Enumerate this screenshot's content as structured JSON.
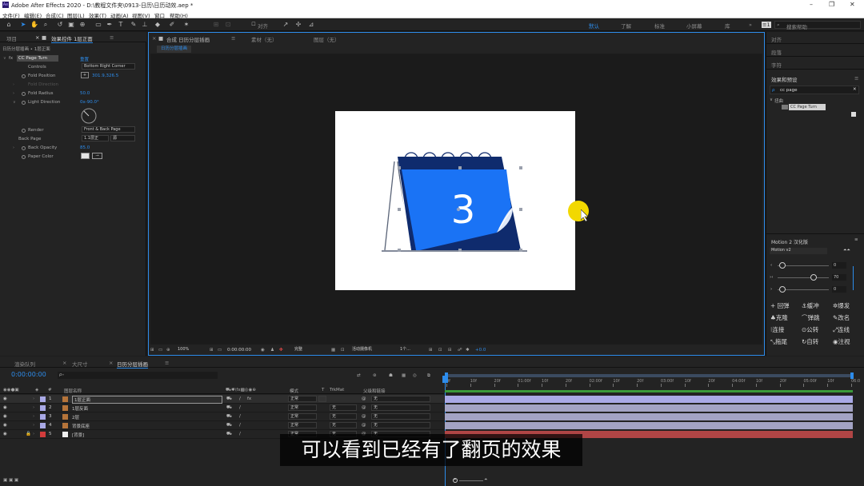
{
  "window": {
    "title": "Adobe After Effects 2020 - D:\\教程文件夹\\0913-日历\\日历动效.aep *",
    "logo": "Ae",
    "controls": [
      "–",
      "❐",
      "✕"
    ]
  },
  "menu": [
    "文件(F)",
    "编辑(E)",
    "合成(C)",
    "图层(L)",
    "效果(T)",
    "动画(A)",
    "视图(V)",
    "窗口",
    "帮助(H)"
  ],
  "toolbar": {
    "align_label": "对齐",
    "workspaces": [
      "默认",
      "了解",
      "标准",
      "小屏幕",
      "库"
    ],
    "search_placeholder": "搜索帮助"
  },
  "effect_controls": {
    "tab_project": "项目",
    "tab_effects": "效果控件 1层正面",
    "path": "日历分层插画 • 1层正面",
    "effect_name": "CC Page Turn",
    "reset": "重置",
    "props": [
      {
        "name": "Controls",
        "value": "Bottom Right Corner",
        "kind": "dropdown"
      },
      {
        "name": "Fold Position",
        "value": "301.9,326.5",
        "kind": "point"
      },
      {
        "name": "Fold Direction",
        "value": "",
        "kind": "disabled"
      },
      {
        "name": "Fold Radius",
        "value": "50.0",
        "kind": "value"
      },
      {
        "name": "Light Direction",
        "value": "0x-90.0°",
        "kind": "angle"
      },
      {
        "name": "Render",
        "value": "Front & Back Page",
        "kind": "dropdown"
      },
      {
        "name": "Back Page",
        "value": "1.1层正",
        "kind": "layer",
        "source": "源"
      },
      {
        "name": "Back Opacity",
        "value": "85.0",
        "kind": "value"
      },
      {
        "name": "Paper Color",
        "value": "",
        "kind": "color"
      }
    ]
  },
  "composition": {
    "tab_comp": "合成 日历分层插画",
    "tab_material": "素材（无）",
    "tab_layer": "图层（无）",
    "breadcrumb": "日历分层插画",
    "calendar_number": "3",
    "viewer": {
      "zoom": "100%",
      "timecode": "0:00:00:00",
      "quality": "完整",
      "camera": "活动摄像机",
      "views": "1个...",
      "exposure": "+0.0"
    }
  },
  "right_panel": {
    "items": [
      "对齐",
      "段落",
      "字符"
    ],
    "effects_title": "效果和预设",
    "search_value": "cc page",
    "category": "扭曲",
    "result": "CC Page Turn",
    "motion": {
      "title": "Motion 2 汉化版",
      "version": "Motion v2",
      "sliders": [
        {
          "label": "‹",
          "value": "0"
        },
        {
          "label": "›‹",
          "value": "70"
        },
        {
          "label": "›",
          "value": "0"
        }
      ],
      "buttons": [
        "回弹",
        "缓冲",
        "爆发",
        "克隆",
        "弹跳",
        "改名",
        "连接",
        "公转",
        "连线",
        "拖尾",
        "自转",
        "注视"
      ]
    }
  },
  "timeline": {
    "tabs": [
      "渲染队列",
      "大尺寸",
      "日历分层插画"
    ],
    "timecode": "0:00:00:00",
    "search_placeholder": "ρ₊",
    "columns": {
      "name": "图层名称",
      "mode": "模式",
      "t": "T",
      "trkmat": "TrkMat",
      "parent": "父级和链接"
    },
    "ruler": [
      "0f",
      "10f",
      "20f",
      "01:00f",
      "10f",
      "20f",
      "02:00f",
      "10f",
      "20f",
      "03:00f",
      "10f",
      "20f",
      "04:00f",
      "10f",
      "20f",
      "05:00f",
      "10f",
      "06:0"
    ],
    "layers": [
      {
        "num": "1",
        "name": "1层正面",
        "mode": "正常",
        "trkmat": "",
        "parent": "无",
        "color": "#a9a9e6",
        "bar": "#a9a9e6",
        "selected": true
      },
      {
        "num": "2",
        "name": "1层反面",
        "mode": "正常",
        "trkmat": "无",
        "parent": "无",
        "color": "#a9a9e6",
        "bar": "#a3a3c4",
        "selected": false
      },
      {
        "num": "3",
        "name": "2层",
        "mode": "正常",
        "trkmat": "无",
        "parent": "无",
        "color": "#a9a9e6",
        "bar": "#a3a3c4",
        "selected": false
      },
      {
        "num": "4",
        "name": "背景底座",
        "mode": "正常",
        "trkmat": "无",
        "parent": "无",
        "color": "#a9a9e6",
        "bar": "#a3a3c4",
        "selected": false
      },
      {
        "num": "5",
        "name": "[背景]",
        "mode": "正常",
        "trkmat": "无",
        "parent": "无",
        "color": "#d23c3c",
        "bar": "#b04545",
        "selected": false
      }
    ]
  },
  "subtitle": "可以看到已经有了翻页的效果",
  "colors": {
    "accent": "#2d8ceb",
    "calendar_blue": "#1a73f5",
    "calendar_dark": "#0f2b6d"
  }
}
